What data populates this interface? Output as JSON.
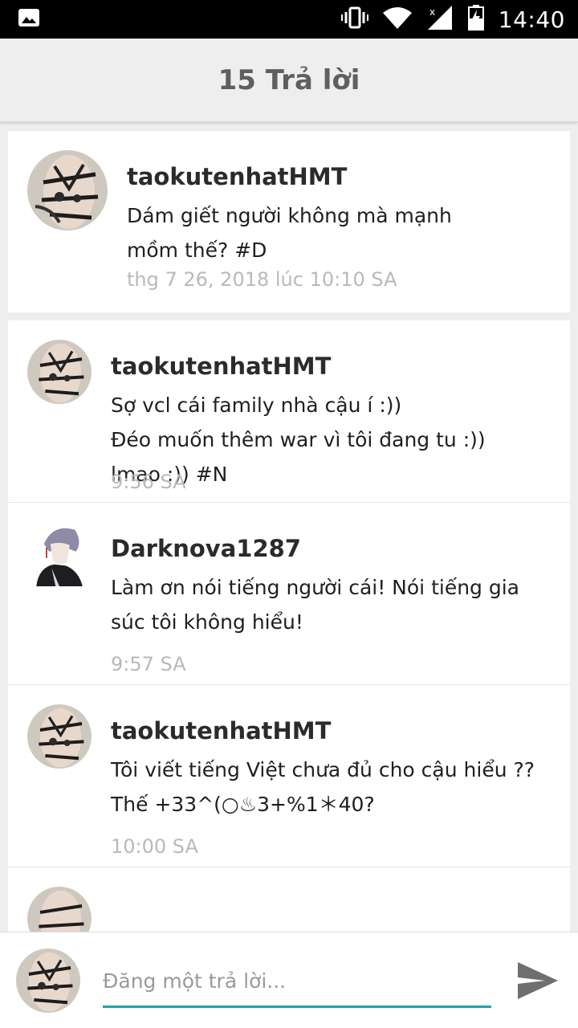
{
  "status_bar": {
    "time": "14:40",
    "icons": [
      "image-icon",
      "vibrate-icon",
      "wifi-icon",
      "signal-icon",
      "battery-icon"
    ]
  },
  "header": {
    "title": "15 Trả lời"
  },
  "main_post": {
    "username": "taokutenhatHMT",
    "message": "Dám giết người không mà mạnh\nmồm thế? #D",
    "timestamp": "thg 7 26, 2018 lúc 10:10 SA"
  },
  "replies": [
    {
      "username": "taokutenhatHMT",
      "message": "Sợ vcl cái family nhà cậu í :))\nĐéo muốn thêm war vì tôi đang tu :))\nlmao :)) #N",
      "timestamp": "9:56 SA"
    },
    {
      "username": "Darknova1287",
      "message": "Làm ơn nói tiếng người cái! Nói tiếng gia\nsúc tôi không hiểu!",
      "timestamp": "9:57 SA"
    },
    {
      "username": "taokutenhatHMT",
      "message": "Tôi viết tiếng Việt chưa đủ cho cậu hiểu ??\nThế +33^(○♨3+%1＊40?",
      "timestamp": "10:00 SA"
    }
  ],
  "composer": {
    "placeholder": "Đăng một trả lời..."
  },
  "colors": {
    "accent": "#20a3a8",
    "status_bar": "#000000",
    "app_bar": "#eeeeee",
    "timestamp": "#b9b9b9"
  }
}
